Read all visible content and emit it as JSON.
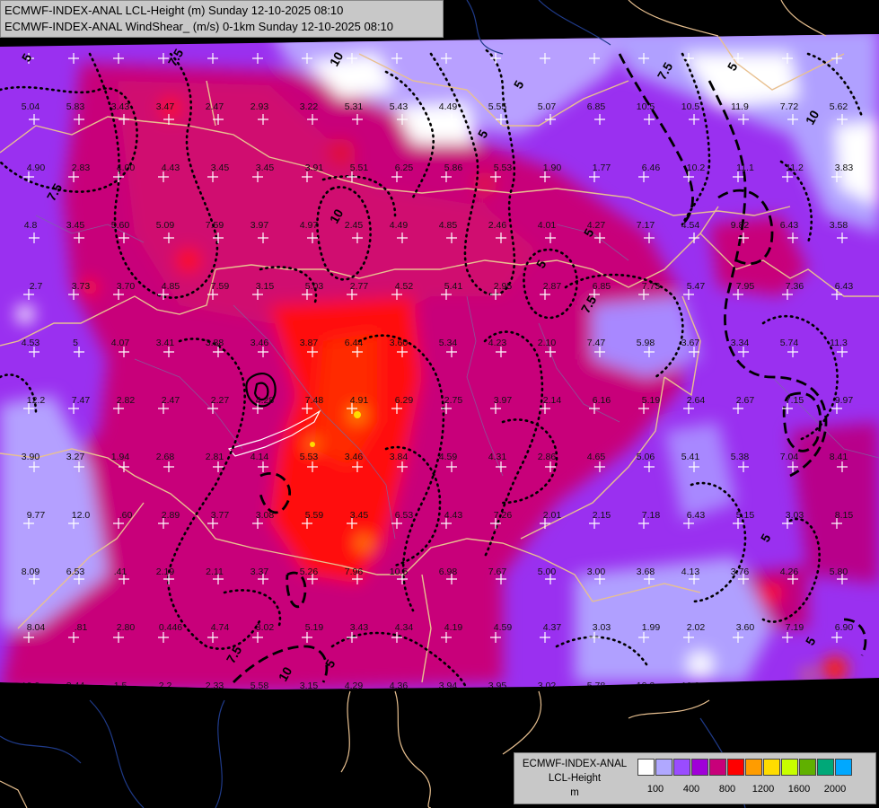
{
  "header": {
    "line1": "ECMWF-INDEX-ANAL LCL-Height (m) Sunday 12-10-2025 08:10",
    "line2": "ECMWF-INDEX-ANAL WindShear_ (m/s) 0-1km Sunday 12-10-2025 08:10"
  },
  "legend": {
    "title_line1": "ECMWF-INDEX-ANAL",
    "title_line2": "LCL-Height",
    "title_line3": "m",
    "colors": [
      "#ffffff",
      "#b0a8ff",
      "#9a4cff",
      "#a000d8",
      "#c8007a",
      "#ff0000",
      "#ff9c00",
      "#ffdc00",
      "#c8ff00",
      "#60b000",
      "#00a878",
      "#00a8ff"
    ],
    "tick_labels": [
      "100",
      "400",
      "800",
      "1200",
      "1600",
      "2000"
    ]
  },
  "map": {
    "contour_labels": [
      "5",
      "7.5",
      "10",
      "5",
      "7.5",
      "5",
      "7.5",
      "10",
      "5",
      "5",
      "7.5",
      "10",
      "5",
      "5",
      "10",
      "5",
      "7.5",
      "5"
    ],
    "values": [
      "5.04",
      "5.83",
      "3.43",
      "3.47",
      "2.47",
      "2.93",
      "3.22",
      "5.31",
      "5.43",
      "4.49",
      "5.55",
      "5.07",
      "6.85",
      "10.5",
      "10.5",
      "11.9",
      "7.72",
      "5.62",
      "4.90",
      "2.83",
      "4.00",
      "4.43",
      "3.45",
      "3.45",
      "3.91",
      "5.51",
      "6.25",
      "5.86",
      "5.53",
      "1.90",
      "1.77",
      "6.46",
      "10.2",
      "11.1",
      "11.2",
      "3.83",
      "4.8",
      "3.45",
      "5.60",
      "5.09",
      "7.59",
      "3.97",
      "4.97",
      "2.45",
      "4.49",
      "4.85",
      "2.46",
      "4.01",
      "4.27",
      "7.17",
      "4.54",
      "9.82",
      "6.43",
      "3.58",
      "2.7",
      "3.73",
      "3.70",
      "4.85",
      "7.59",
      "3.15",
      "5.03",
      "2.77",
      "4.52",
      "5.41",
      "2.95",
      "2.87",
      "6.85",
      "7.73",
      "5.47",
      "7.95",
      "7.36",
      "6.43",
      "4.53",
      "5",
      "4.07",
      "3.41",
      "3.88",
      "3.46",
      "3.87",
      "6.44",
      "3.60",
      "5.34",
      "4.23",
      "2.10",
      "7.47",
      "5.98",
      "3.67",
      "3.34",
      "5.74",
      "11.3",
      "12.2",
      "7.47",
      "2.82",
      "2.47",
      "2.27",
      "4.28",
      "7.48",
      "4.91",
      "6.29",
      "2.75",
      "3.97",
      "2.14",
      "6.16",
      "5.19",
      "2.64",
      "2.67",
      "7.15",
      "9.97",
      "3.90",
      "3.27",
      "1.94",
      "2.68",
      "2.81",
      "4.14",
      "5.53",
      "3.46",
      "3.84",
      "4.59",
      "4.31",
      "2.86",
      "4.65",
      "5.06",
      "5.41",
      "5.38",
      "7.04",
      "8.41",
      "9.77",
      "12.0",
      ".60",
      "2.89",
      "3.77",
      "3.08",
      "5.59",
      "3.45",
      "6.53",
      "4.43",
      "7.26",
      "2.01",
      "2.15",
      "7.18",
      "6.43",
      "5.15",
      "3.03",
      "8.15",
      "8.09",
      "6.53",
      ".41",
      "2.19",
      "2.11",
      "3.37",
      "5.26",
      "7.96",
      "10.5",
      "6.98",
      "7.67",
      "5.00",
      "3.00",
      "3.68",
      "4.13",
      "3.76",
      "4.26",
      "5.80",
      "8.04",
      ".81",
      "2.80",
      "0.446",
      "4.74",
      "3.02",
      "5.19",
      "3.43",
      "4.34",
      "4.19",
      "4.59",
      "4.37",
      "3.03",
      "1.99",
      "2.02",
      "3.60",
      "7.19",
      "6.90",
      "12.0",
      "2.44",
      "1.5",
      "2.2",
      "2.33",
      "5.58",
      "3.15",
      "4.29",
      "4.36",
      "3.94",
      "3.95",
      "3.02",
      "5.78",
      "10.2",
      "10.3"
    ]
  }
}
